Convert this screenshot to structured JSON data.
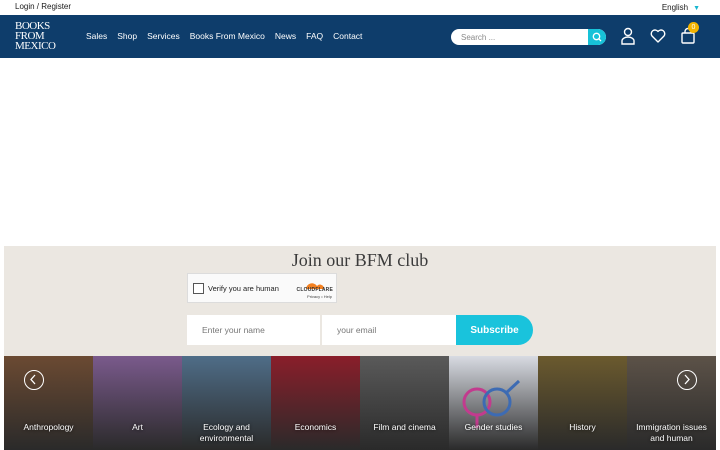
{
  "topbar": {
    "login": "Login / Register",
    "language": "English"
  },
  "nav": {
    "logo_line1": "BOOKS",
    "logo_line2": "FROM",
    "logo_line3": "MEXICO",
    "items": [
      "Sales",
      "Shop",
      "Services",
      "Books From Mexico",
      "News",
      "FAQ",
      "Contact"
    ],
    "search_placeholder": "Search ...",
    "cart_count": "0"
  },
  "club": {
    "title": "Join our BFM club",
    "captcha_label": "Verify you are human",
    "captcha_brand": "CLOUDFLARE",
    "captcha_links": "Privacy • Help",
    "name_placeholder": "Enter your name",
    "email_placeholder": "your email",
    "subscribe_label": "Subscribe"
  },
  "categories": [
    {
      "label": "Anthropology",
      "color": "#6b4a32"
    },
    {
      "label": "Art",
      "color": "#7a5a8c"
    },
    {
      "label": "Ecology and environmental",
      "color": "#4f6d88"
    },
    {
      "label": "Economics",
      "color": "#8a1e2a"
    },
    {
      "label": "Film and cinema",
      "color": "#5a5a5a"
    },
    {
      "label": "Gender studies",
      "color": "#d8dbe2"
    },
    {
      "label": "History",
      "color": "#6b5a2e"
    },
    {
      "label": "Immigration issues and human",
      "color": "#5c5248"
    }
  ],
  "colors": {
    "nav_bg": "#0e3d6b",
    "accent": "#19c3dc",
    "club_bg": "#ebe7e1",
    "badge": "#f5b400"
  }
}
